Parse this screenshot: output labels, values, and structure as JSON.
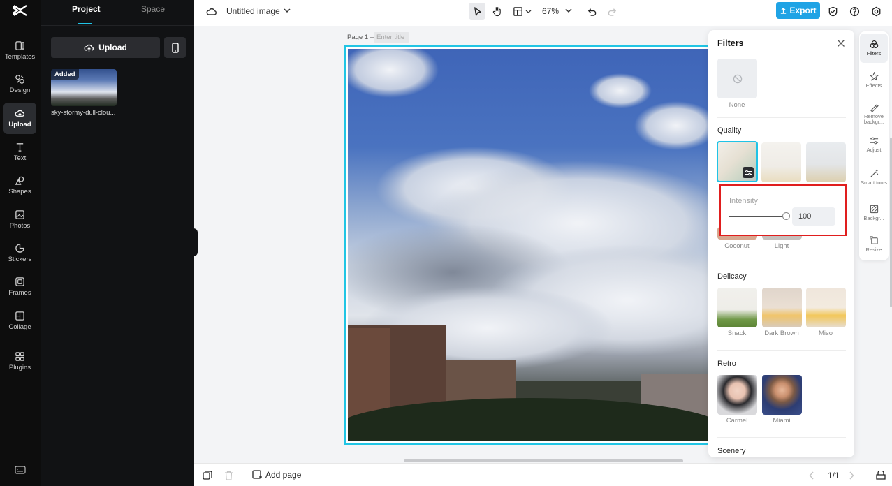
{
  "left_rail": {
    "items": [
      {
        "label": "Templates",
        "icon": "templates-icon"
      },
      {
        "label": "Design",
        "icon": "design-icon"
      },
      {
        "label": "Upload",
        "icon": "upload-cloud-icon",
        "active": true
      },
      {
        "label": "Text",
        "icon": "text-icon"
      },
      {
        "label": "Shapes",
        "icon": "shapes-icon"
      },
      {
        "label": "Photos",
        "icon": "photos-icon"
      },
      {
        "label": "Stickers",
        "icon": "stickers-icon"
      },
      {
        "label": "Frames",
        "icon": "frames-icon"
      },
      {
        "label": "Collage",
        "icon": "collage-icon"
      },
      {
        "label": "Plugins",
        "icon": "plugins-icon"
      }
    ]
  },
  "panel": {
    "tabs": [
      {
        "label": "Project",
        "active": true
      },
      {
        "label": "Space"
      }
    ],
    "upload_label": "Upload",
    "asset": {
      "badge": "Added",
      "name": "sky-stormy-dull-clou..."
    }
  },
  "topbar": {
    "doc_title": "Untitled image",
    "zoom": "67%",
    "export_label": "Export"
  },
  "canvas": {
    "page_label": "Page 1 –",
    "title_placeholder": "Enter title"
  },
  "bottombar": {
    "add_page_label": "Add page",
    "pager": "1/1"
  },
  "filters": {
    "title": "Filters",
    "none_label": "None",
    "sections": {
      "quality": "Quality",
      "delicacy": "Delicacy",
      "retro": "Retro",
      "scenery": "Scenery"
    },
    "quality_labels": [
      "Coconut",
      "Light"
    ],
    "delicacy_labels": [
      "Snack",
      "Dark Brown",
      "Miso"
    ],
    "retro_labels": [
      "Carmel",
      "Miami"
    ],
    "intensity": {
      "label": "Intensity",
      "value": "100",
      "fraction": 1.0
    }
  },
  "right_rail": {
    "items": [
      {
        "label": "Filters",
        "icon": "filters-icon",
        "active": true
      },
      {
        "label": "Effects",
        "icon": "effects-icon"
      },
      {
        "label": "Remove backgr...",
        "icon": "remove-background-icon"
      },
      {
        "label": "Adjust",
        "icon": "adjust-icon"
      },
      {
        "label": "Smart tools",
        "icon": "smart-tools-icon"
      },
      {
        "label": "Backgr...",
        "icon": "background-icon"
      },
      {
        "label": "Resize",
        "icon": "resize-icon"
      }
    ]
  },
  "colors": {
    "accent": "#20c3e6",
    "export": "#1fa3e5",
    "highlight_box": "#e01e1e"
  }
}
